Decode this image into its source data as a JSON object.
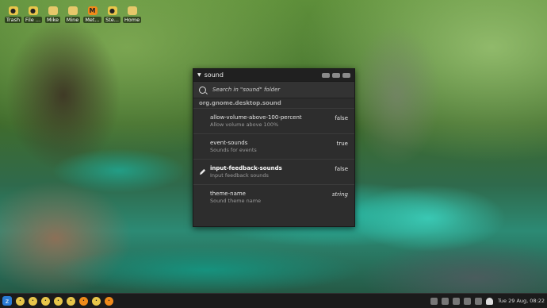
{
  "desktop": {
    "icons": [
      {
        "label": "Trash",
        "icon": "trash-icon",
        "color": "#e8c64a"
      },
      {
        "label": "File ...",
        "icon": "file-manager-icon",
        "color": "#e8c64a"
      },
      {
        "label": "Mike",
        "icon": "folder-icon",
        "color": "#e6c86a"
      },
      {
        "label": "Mine",
        "icon": "folder-icon",
        "color": "#e6c86a"
      },
      {
        "label": "Met...",
        "icon": "metadata-app-icon",
        "glyph": "M",
        "color": "#f08a1a"
      },
      {
        "label": "Ste...",
        "icon": "steam-icon",
        "color": "#e8c64a"
      },
      {
        "label": "Home",
        "icon": "home-folder-icon",
        "color": "#e6c86a"
      }
    ]
  },
  "popup": {
    "title": "sound",
    "search_placeholder": "Search in \"sound\" folder",
    "schema": "org.gnome.desktop.sound",
    "keys": [
      {
        "name": "allow-volume-above-100-percent",
        "desc": "Allow volume above 100%",
        "value": "false"
      },
      {
        "name": "event-sounds",
        "desc": "Sounds for events",
        "value": "true"
      },
      {
        "name": "input-feedback-sounds",
        "desc": "Input feedback sounds",
        "value": "false"
      },
      {
        "name": "theme-name",
        "desc": "Sound theme name",
        "value": "string"
      }
    ]
  },
  "taskbar": {
    "launchers": [
      {
        "icon": "launcher-icon",
        "color": "#e8c64a"
      },
      {
        "icon": "launcher-icon",
        "color": "#e8c64a"
      },
      {
        "icon": "launcher-icon",
        "color": "#e8c64a"
      },
      {
        "icon": "launcher-icon",
        "color": "#e8c64a"
      },
      {
        "icon": "launcher-icon",
        "color": "#e8c64a"
      },
      {
        "icon": "launcher-icon",
        "color": "#f08a1a"
      },
      {
        "icon": "launcher-icon",
        "color": "#e8c64a"
      },
      {
        "icon": "launcher-icon",
        "color": "#f08a1a"
      }
    ],
    "clock": "Tue 29 Aug, 08:22"
  },
  "colors": {
    "accent": "#2a7bd5",
    "popup_bg": "#2d2d2d"
  }
}
